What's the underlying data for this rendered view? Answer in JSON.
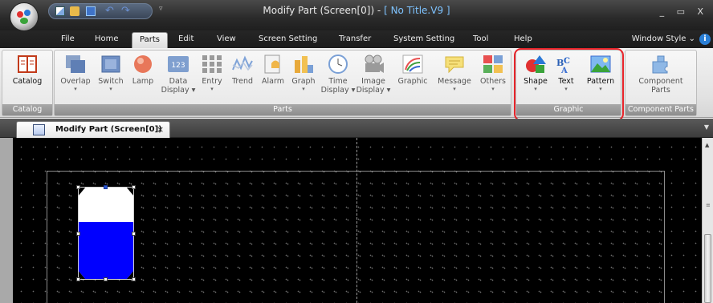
{
  "window": {
    "title_main": "Modify Part (Screen[0]) - ",
    "title_doc": "[ No Title.V9 ]",
    "controls": "_ ▭ X"
  },
  "menu_tabs": [
    {
      "label": "File"
    },
    {
      "label": "Home"
    },
    {
      "label": "Parts"
    },
    {
      "label": "Edit"
    },
    {
      "label": "View"
    },
    {
      "label": "Screen Setting"
    },
    {
      "label": "Transfer"
    },
    {
      "label": "System Setting"
    },
    {
      "label": "Tool"
    },
    {
      "label": "Help"
    }
  ],
  "window_style": "Window Style",
  "help_icon": "i",
  "ribbon": {
    "groups": {
      "catalog": "Catalog",
      "parts": "Parts",
      "graphic": "Graphic",
      "component_parts": "Component Parts"
    },
    "buttons": {
      "catalog": "Catalog",
      "overlap": "Overlap",
      "switch": "Switch",
      "lamp": "Lamp",
      "data_display_1": "Data",
      "data_display_2": "Display",
      "data_icon_text": "123",
      "entry": "Entry",
      "trend": "Trend",
      "alarm": "Alarm",
      "graph": "Graph",
      "time_display_1": "Time",
      "time_display_2": "Display",
      "image_display_1": "Image",
      "image_display_2": "Display",
      "graphic": "Graphic",
      "message": "Message",
      "others": "Others",
      "shape": "Shape",
      "text": "Text",
      "pattern": "Pattern",
      "component_parts_1": "Component",
      "component_parts_2": "Parts"
    },
    "dropdown_arrow": "▾"
  },
  "document_tab": {
    "label": "Modify Part (Screen[0])",
    "close": "×"
  },
  "colors": {
    "highlight": "#e8242a",
    "tank_fill": "#0000ff",
    "canvas": "#000000"
  }
}
